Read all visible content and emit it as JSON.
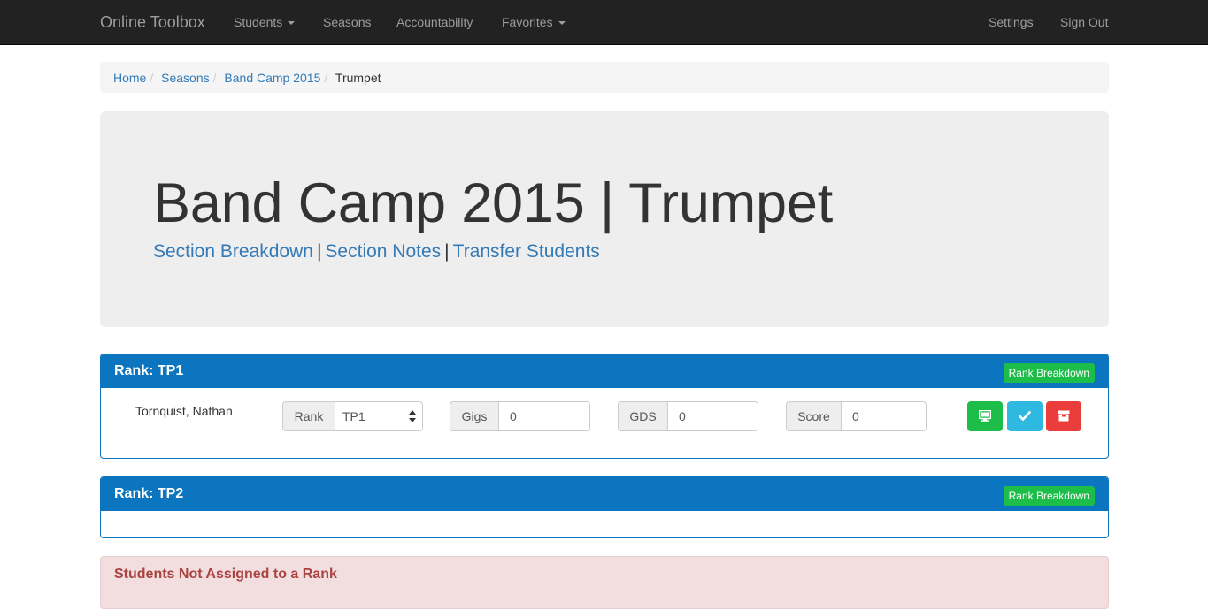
{
  "navbar": {
    "brand": "Online Toolbox",
    "left_items": [
      {
        "label": "Students",
        "dropdown": true
      },
      {
        "label": "Seasons",
        "dropdown": false
      },
      {
        "label": "Accountability",
        "dropdown": false
      },
      {
        "label": "Favorites",
        "dropdown": true
      }
    ],
    "right_items": [
      {
        "label": "Settings"
      },
      {
        "label": "Sign Out"
      }
    ]
  },
  "breadcrumb": {
    "items": [
      "Home",
      "Seasons",
      "Band Camp 2015"
    ],
    "active": "Trumpet",
    "separator": "/"
  },
  "jumbotron": {
    "title": "Band Camp 2015 | Trumpet",
    "links": [
      "Section Breakdown",
      "Section Notes",
      "Transfer Students"
    ],
    "link_separator": "|"
  },
  "ranks": [
    {
      "title": "Rank: TP1",
      "breakdown_label": "Rank Breakdown",
      "students": [
        {
          "name": "Tornquist, Nathan",
          "rank_label": "Rank",
          "rank_value": "TP1",
          "gigs_label": "Gigs",
          "gigs_value": "0",
          "gds_label": "GDS",
          "gds_value": "0",
          "score_label": "Score",
          "score_value": "0"
        }
      ]
    },
    {
      "title": "Rank: TP2",
      "breakdown_label": "Rank Breakdown",
      "students": []
    }
  ],
  "unassigned": {
    "title": "Students Not Assigned to a Rank"
  },
  "action_icons": [
    "monitor-icon",
    "checkmark-icon",
    "archive-icon"
  ],
  "colors": {
    "navbar_bg": "#222222",
    "link": "#337ab7",
    "panel_primary": "#0b75bf",
    "success": "#1cbd49",
    "info": "#2fb8e0",
    "danger": "#ec3d3d",
    "danger_panel_bg": "#f2dede",
    "danger_text": "#a94442"
  }
}
